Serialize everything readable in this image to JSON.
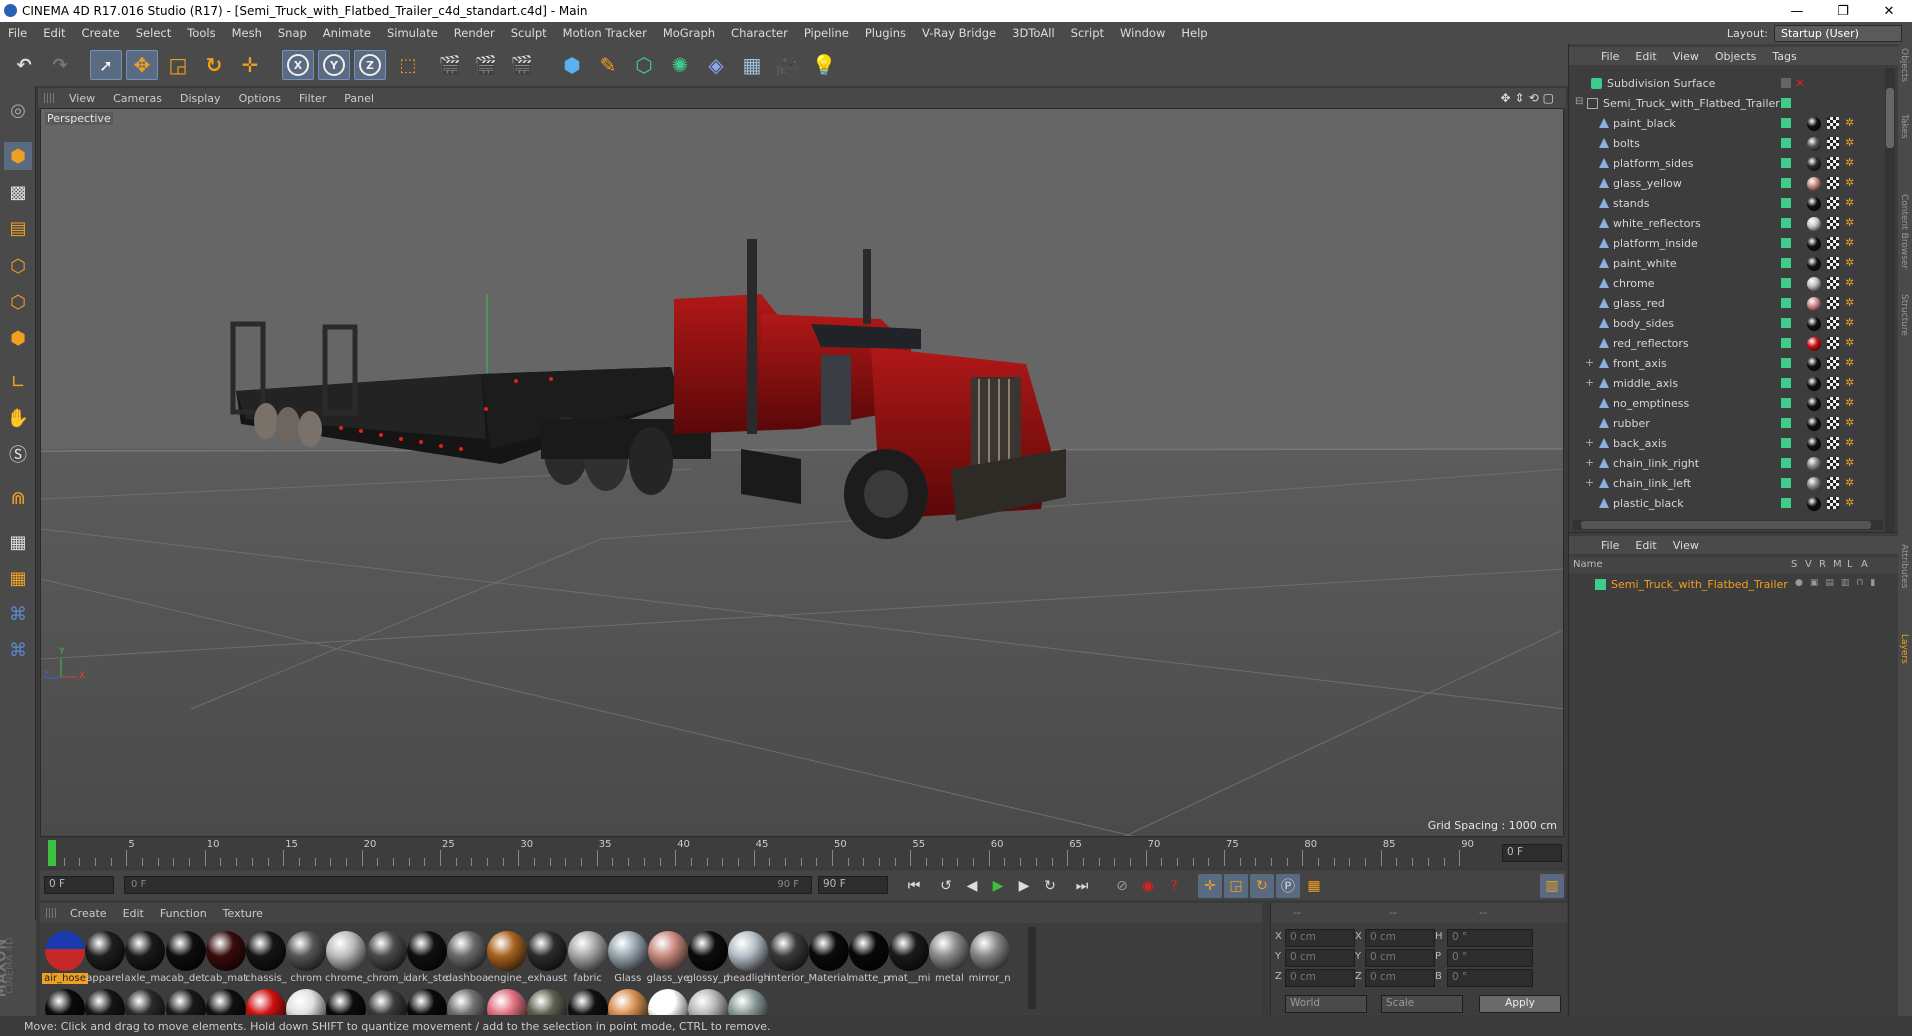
{
  "window": {
    "title": "CINEMA 4D R17.016 Studio (R17) - [Semi_Truck_with_Flatbed_Trailer_c4d_standart.c4d] - Main",
    "controls": [
      "—",
      "❐",
      "✕"
    ]
  },
  "menubar": [
    "File",
    "Edit",
    "Create",
    "Select",
    "Tools",
    "Mesh",
    "Snap",
    "Animate",
    "Simulate",
    "Render",
    "Sculpt",
    "Motion Tracker",
    "MoGraph",
    "Character",
    "Pipeline",
    "Plugins",
    "V-Ray Bridge",
    "3DToAll",
    "Script",
    "Window",
    "Help"
  ],
  "layout": {
    "label": "Layout:",
    "value": "Startup (User)"
  },
  "toolbar": {
    "x": "X",
    "y": "Y",
    "z": "Z"
  },
  "viewport": {
    "menu": [
      "View",
      "Cameras",
      "Display",
      "Options",
      "Filter",
      "Panel"
    ],
    "label": "Perspective",
    "grid_spacing": "Grid Spacing : 1000 cm"
  },
  "timeline": {
    "ticks": [
      "0",
      "5",
      "10",
      "15",
      "20",
      "25",
      "30",
      "35",
      "40",
      "45",
      "50",
      "55",
      "60",
      "65",
      "70",
      "75",
      "80",
      "85",
      "90"
    ],
    "current_frame": "0 F"
  },
  "transport": {
    "start": "0 F",
    "range_start": "0 F",
    "range_end": "90 F",
    "end": "90 F"
  },
  "materials": {
    "menu": [
      "Create",
      "Edit",
      "Function",
      "Texture"
    ],
    "row1": [
      {
        "name": "air_hose",
        "color": "#c42828"
      },
      {
        "name": "apparel",
        "color": "#1e1e1e"
      },
      {
        "name": "axle_ma",
        "color": "#1a1a1a"
      },
      {
        "name": "cab_det",
        "color": "#0e0e0e"
      },
      {
        "name": "cab_mat",
        "color": "#3a0c0c"
      },
      {
        "name": "chassis_",
        "color": "#151515"
      },
      {
        "name": "chrom",
        "color": "#555555"
      },
      {
        "name": "chrome_",
        "color": "#bdbdbd"
      },
      {
        "name": "chrom_i",
        "color": "#4a4a4a"
      },
      {
        "name": "dark_ste",
        "color": "#101010"
      },
      {
        "name": "dashboa",
        "color": "#6a6a6a"
      },
      {
        "name": "engine_",
        "color": "#a86420"
      },
      {
        "name": "exhaust",
        "color": "#2c2c2c"
      },
      {
        "name": "fabric",
        "color": "#a8a8a8"
      },
      {
        "name": "Glass",
        "color": "#9aa8b0"
      },
      {
        "name": "glass_ye",
        "color": "#c88a7e"
      },
      {
        "name": "glossy_p",
        "color": "#0c0c0c"
      },
      {
        "name": "headligh",
        "color": "#b8c0c8"
      },
      {
        "name": "interior_",
        "color": "#3a3a3a"
      },
      {
        "name": "Material",
        "color": "#0a0a0a"
      },
      {
        "name": "matte_p",
        "color": "#080808"
      },
      {
        "name": "mat__mi",
        "color": "#1a1a1a"
      },
      {
        "name": "metal",
        "color": "#8c8c8c"
      },
      {
        "name": "mirror_n",
        "color": "#888888"
      }
    ],
    "row2_colors": [
      "#0a0a0a",
      "#151515",
      "#2a2a2a",
      "#1a1a1a",
      "#101010",
      "#d01010",
      "#e0e0e0",
      "#0c0c0c",
      "#3a3a3a",
      "#0a0a0a",
      "#707070",
      "#e07080",
      "#606050",
      "#101010",
      "#d89050",
      "#ffffff",
      "#b8b8b8",
      "#8a9a98"
    ]
  },
  "coordinates": {
    "header": [
      "--",
      "--",
      "--"
    ],
    "rows": [
      {
        "a": "X",
        "av": "0 cm",
        "b": "X",
        "bv": "0 cm",
        "c": "H",
        "cv": "0 °"
      },
      {
        "a": "Y",
        "av": "0 cm",
        "b": "Y",
        "bv": "0 cm",
        "c": "P",
        "cv": "0 °"
      },
      {
        "a": "Z",
        "av": "0 cm",
        "b": "Z",
        "bv": "0 cm",
        "c": "B",
        "cv": "0 °"
      }
    ],
    "mode1": "World",
    "mode2": "Scale",
    "apply": "Apply"
  },
  "object_manager": {
    "menu": [
      "File",
      "Edit",
      "View",
      "Objects",
      "Tags"
    ],
    "subdivision": "Subdivision Surface",
    "root": "Semi_Truck_with_Flatbed_Trailer",
    "children": [
      {
        "name": "paint_black",
        "tag": "#101010",
        "expand": ""
      },
      {
        "name": "bolts",
        "tag": "#555555",
        "expand": ""
      },
      {
        "name": "platform_sides",
        "tag": "#2a2a2a",
        "expand": ""
      },
      {
        "name": "glass_yellow",
        "tag": "#c88a7e",
        "expand": ""
      },
      {
        "name": "stands",
        "tag": "#101010",
        "expand": ""
      },
      {
        "name": "white_reflectors",
        "tag": "#c8c8c8",
        "expand": ""
      },
      {
        "name": "platform_inside",
        "tag": "#101010",
        "expand": ""
      },
      {
        "name": "paint_white",
        "tag": "#151515",
        "expand": ""
      },
      {
        "name": "chrome",
        "tag": "#bdbdbd",
        "expand": ""
      },
      {
        "name": "glass_red",
        "tag": "#d08888",
        "expand": ""
      },
      {
        "name": "body_sides",
        "tag": "#101010",
        "expand": ""
      },
      {
        "name": "red_reflectors",
        "tag": "#d01010",
        "expand": ""
      },
      {
        "name": "front_axis",
        "tag": "#101010",
        "expand": "+"
      },
      {
        "name": "middle_axis",
        "tag": "#101010",
        "expand": "+"
      },
      {
        "name": "no_emptiness",
        "tag": "#101010",
        "expand": ""
      },
      {
        "name": "rubber",
        "tag": "#101010",
        "expand": ""
      },
      {
        "name": "back_axis",
        "tag": "#101010",
        "expand": "+"
      },
      {
        "name": "chain_link_right",
        "tag": "#888888",
        "expand": "+"
      },
      {
        "name": "chain_link_left",
        "tag": "#888888",
        "expand": "+"
      },
      {
        "name": "plastic_black",
        "tag": "#101010",
        "expand": ""
      }
    ]
  },
  "layer_manager": {
    "menu": [
      "File",
      "Edit",
      "View"
    ],
    "columns": [
      "Name",
      "S",
      "V",
      "R",
      "M",
      "L",
      "A"
    ],
    "row": "Semi_Truck_with_Flatbed_Trailer"
  },
  "right_strip_tabs": [
    "Objects",
    "Takes",
    "Content Browser",
    "Structure",
    "Attributes",
    "Layers"
  ],
  "status": "Move: Click and drag to move elements. Hold down SHIFT to quantize movement / add to the selection in point mode, CTRL to remove.",
  "colors": {
    "accent_orange": "#f0a020",
    "active_green": "#3dcc8a",
    "truck_red": "#8a1010"
  }
}
